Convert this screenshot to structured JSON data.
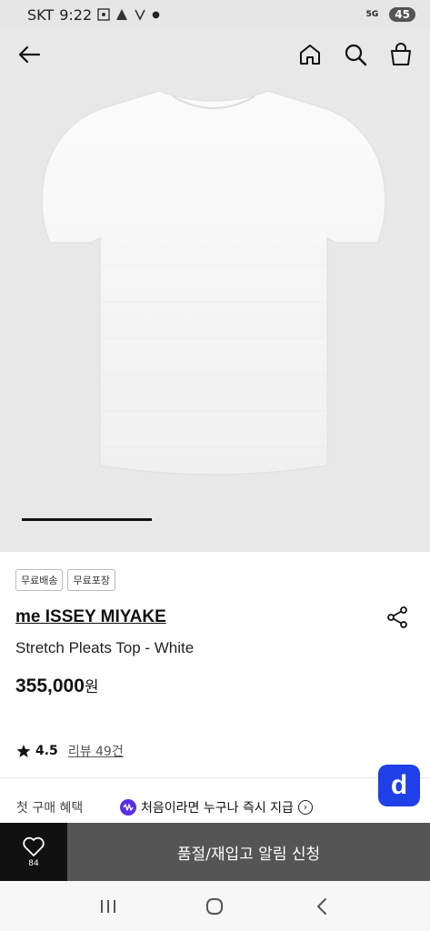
{
  "status_bar": {
    "carrier": "SKT",
    "time": "9:22",
    "battery": "45",
    "network": "5G"
  },
  "product": {
    "tags": [
      "무료배송",
      "무료포장"
    ],
    "brand": "me ISSEY MIYAKE",
    "name": "Stretch Pleats Top - White",
    "price": "355,000",
    "price_unit": "원",
    "rating": "4.5",
    "reviews": "리뷰 49건"
  },
  "benefit": {
    "label": "첫 구매 혜택",
    "text": "처음이라면 누구나 즉시 지급"
  },
  "action_bar": {
    "like_count": "84",
    "notify_label": "품절/재입고 알림 신청"
  },
  "fab": {
    "label": "d"
  },
  "icons": {
    "back": "arrow-left-icon",
    "home": "home-icon",
    "search": "search-icon",
    "bag": "shopping-bag-icon",
    "share": "share-icon",
    "star": "star-icon",
    "heart": "heart-icon"
  },
  "colors": {
    "accent": "#1f3fe8",
    "purple": "#5a2ee6",
    "button_gray": "#555555",
    "like_bg": "#111111"
  }
}
